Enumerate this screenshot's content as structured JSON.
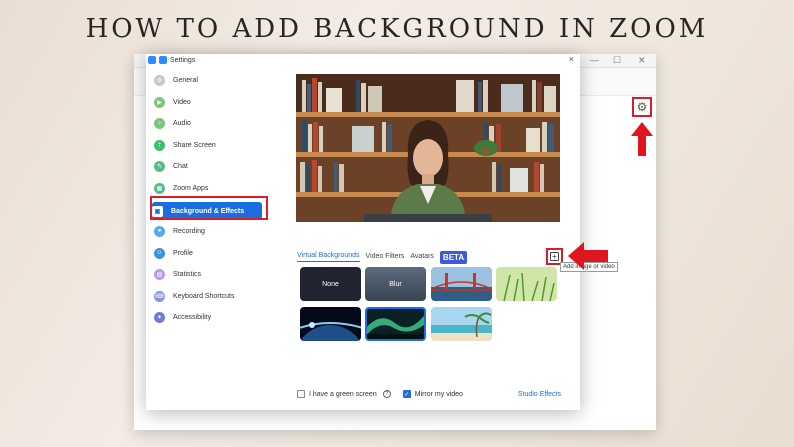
{
  "headline": "HOW TO ADD BACKGROUND IN ZOOM",
  "settings": {
    "title": "Settings",
    "close_glyph": "×"
  },
  "sidebar": {
    "items": [
      {
        "label": "General",
        "icon": "gear-icon",
        "color": "#c7c7c7"
      },
      {
        "label": "Video",
        "icon": "video-icon",
        "color": "#7cc47f"
      },
      {
        "label": "Audio",
        "icon": "headphones-icon",
        "color": "#7cc47f"
      },
      {
        "label": "Share Screen",
        "icon": "share-screen-icon",
        "color": "#3fbf6a"
      },
      {
        "label": "Chat",
        "icon": "chat-icon",
        "color": "#5ab987"
      },
      {
        "label": "Zoom Apps",
        "icon": "apps-icon",
        "color": "#5ab987"
      },
      {
        "label": "Background & Effects",
        "icon": "person-icon",
        "color": "#1a6fe0",
        "active": true
      },
      {
        "label": "Recording",
        "icon": "record-icon",
        "color": "#58a9f0"
      },
      {
        "label": "Profile",
        "icon": "profile-icon",
        "color": "#3e8fe0"
      },
      {
        "label": "Statistics",
        "icon": "stats-icon",
        "color": "#b79be3"
      },
      {
        "label": "Keyboard Shortcuts",
        "icon": "keyboard-icon",
        "color": "#8a8fe0"
      },
      {
        "label": "Accessibility",
        "icon": "accessibility-icon",
        "color": "#6b7fd8"
      }
    ]
  },
  "tabs": {
    "virtual_backgrounds": "Virtual Backgrounds",
    "video_filters": "Video Filters",
    "avatars": "Avatars",
    "beta": "BETA"
  },
  "add_button": {
    "glyph": "+",
    "tooltip": "Add image or video"
  },
  "backgrounds": [
    {
      "label": "None"
    },
    {
      "label": "Blur"
    },
    {
      "label": ""
    },
    {
      "label": ""
    },
    {
      "label": ""
    },
    {
      "label": ""
    },
    {
      "label": ""
    }
  ],
  "options": {
    "green_screen": "I have a green screen",
    "green_screen_checked": false,
    "help_glyph": "?",
    "mirror": "Mirror my video",
    "mirror_checked": true,
    "studio_effects": "Studio Effects"
  },
  "colors": {
    "accent": "#1a6fe0",
    "highlight": "#d81e2b"
  }
}
